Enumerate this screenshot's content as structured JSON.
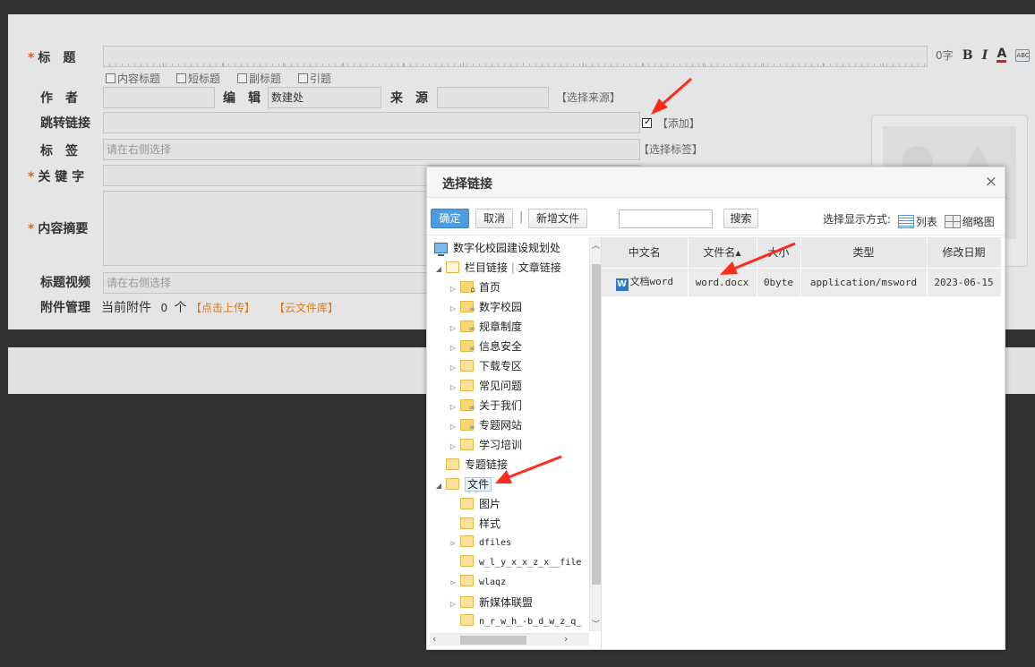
{
  "form": {
    "title_label": "标　题",
    "title_count": "0字",
    "title_checkboxes": [
      "内容标题",
      "短标题",
      "副标题",
      "引题"
    ],
    "author_label": "作　者",
    "editor_label": "编　辑",
    "editor_value": "数建处",
    "source_label": "来　源",
    "source_link": "【选择来源】",
    "jump_link_label": "跳转链接",
    "jump_add": "【添加】",
    "tags_label": "标　签",
    "tags_placeholder": "请在右侧选择",
    "tags_link": "【选择标签】",
    "keywords_label": "关 键 字",
    "summary_label": "内容摘要",
    "video_label": "标题视频",
    "video_placeholder": "请在右侧选择",
    "attach_label": "附件管理",
    "attach_current": "当前附件",
    "attach_count": "0",
    "attach_unit": "个",
    "attach_upload": "【点击上传】",
    "attach_cloud": "【云文件库】",
    "format_bold": "B",
    "format_italic": "I",
    "format_color": "A",
    "format_spell": "ABC"
  },
  "dialog": {
    "title": "选择链接",
    "close": "×",
    "confirm": "确定",
    "cancel": "取消",
    "separator": "|",
    "new_file": "新增文件",
    "search_button": "搜索",
    "view_mode_label": "选择显示方式:",
    "view_list": "列表",
    "view_thumb": "缩略图"
  },
  "tree": {
    "root": "数字化校园建设规划处",
    "column_links": "栏目链接",
    "article_links": "文章链接",
    "items": [
      "首页",
      "数字校园",
      "规章制度",
      "信息安全",
      "下载专区",
      "常见问题",
      "关于我们",
      "专题网站",
      "学习培训"
    ],
    "topic_links": "专题链接",
    "files": "文件",
    "file_children": [
      "图片",
      "样式",
      "dfiles",
      "w_l_y_x_x_z_x__file",
      "wlaqz",
      "新媒体联盟",
      "n_r_w_h_-b_d_w_z_q_"
    ]
  },
  "table": {
    "headers": [
      "中文名",
      "文件名",
      "大小",
      "类型",
      "修改日期"
    ],
    "sort_indicator": "▲",
    "rows": [
      {
        "icon": "W",
        "cn_name": "文档word",
        "file_name": "word.docx",
        "size": "0byte",
        "type": "application/msword",
        "date": "2023-06-15"
      }
    ]
  },
  "colors": {
    "background": "#333333",
    "accent_blue": "#4c9ce2",
    "required_star": "#d9642a",
    "link_orange": "#d9791c",
    "annotation_red": "#ff2a1a"
  }
}
